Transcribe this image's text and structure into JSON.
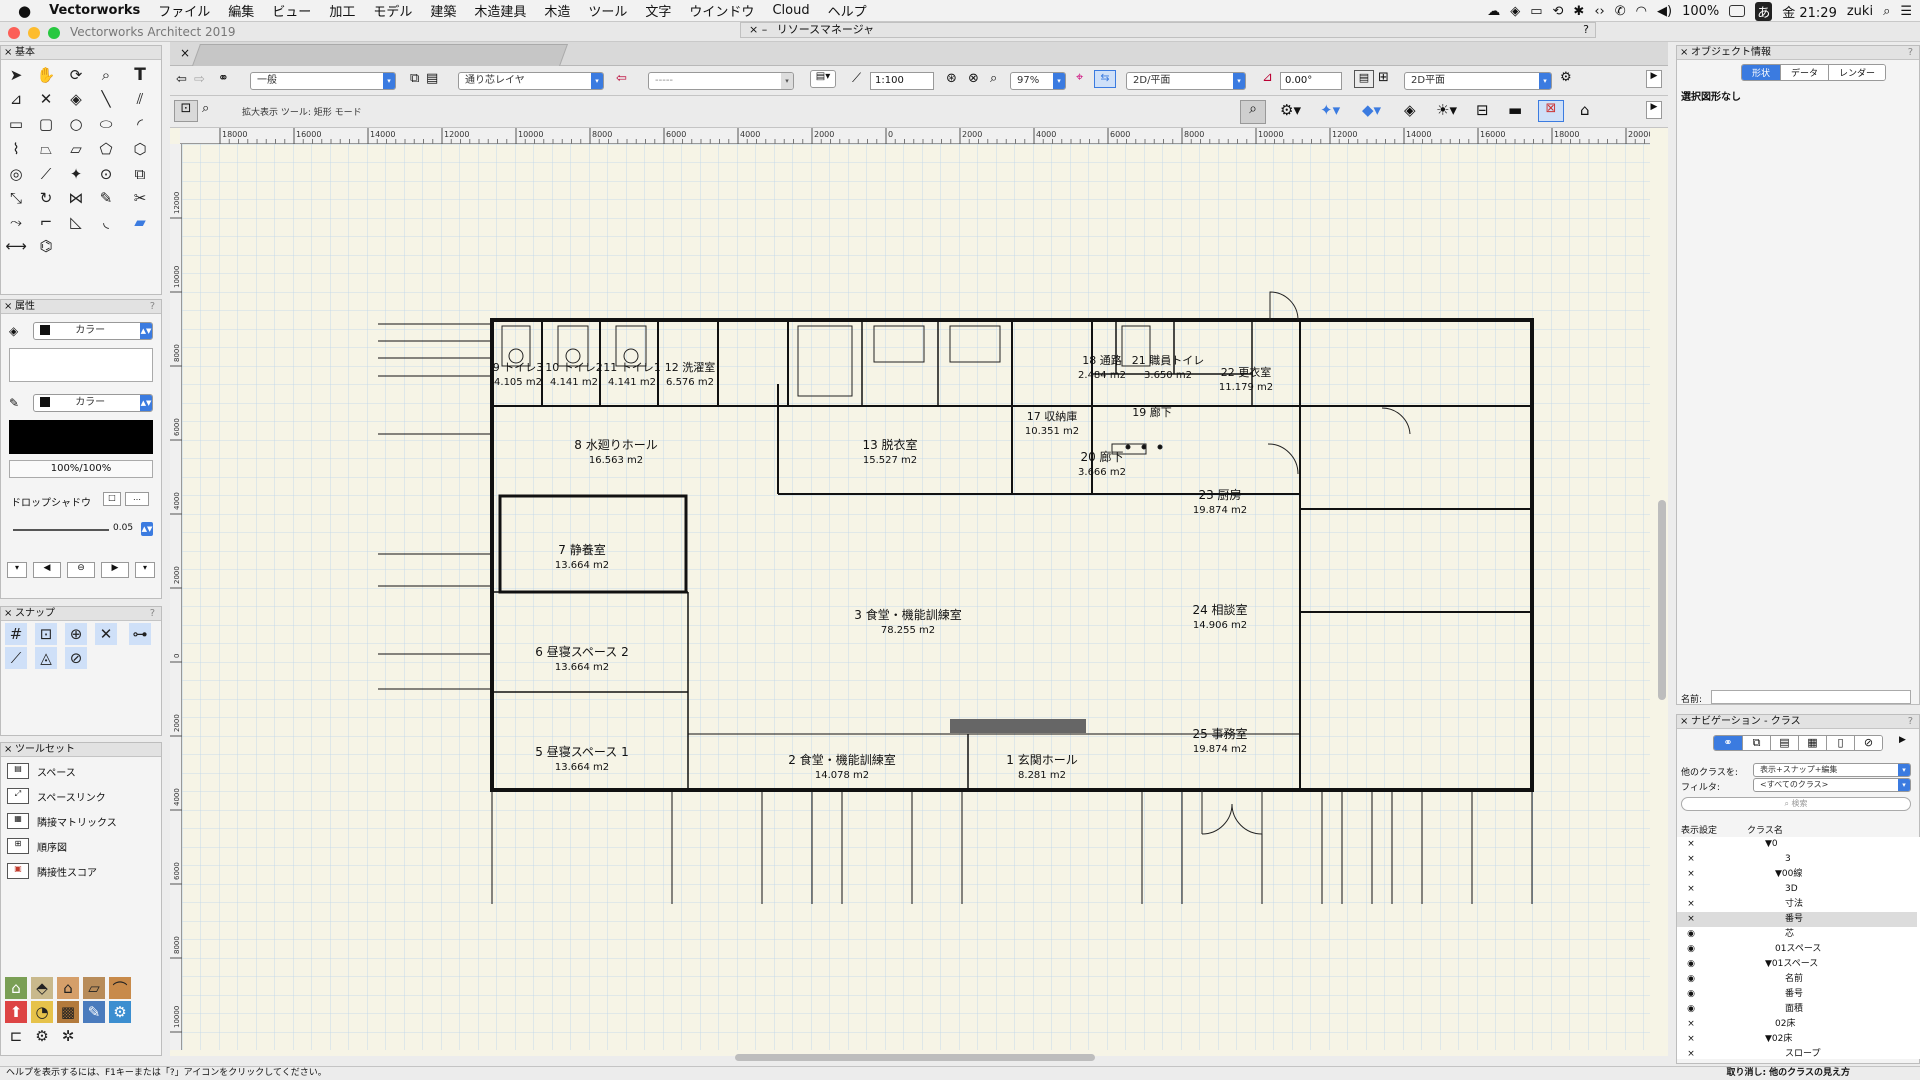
{
  "menubar": {
    "apple": "",
    "app_name": "Vectorworks",
    "items": [
      "ファイル",
      "編集",
      "ビュー",
      "加工",
      "モデル",
      "建築",
      "木造建具",
      "木造",
      "ツール",
      "文字",
      "ウインドウ",
      "Cloud",
      "ヘルプ"
    ],
    "battery": "100%",
    "clock": "金 21:29",
    "user": "zuki",
    "input_mode": "あ"
  },
  "window": {
    "title": "Vectorworks Architect 2019",
    "resource_manager": "リソースマネージャ"
  },
  "palettes": {
    "basic": {
      "title": "基本"
    },
    "attributes": {
      "title": "属性",
      "fill_label": "カラー",
      "pen_label": "カラー",
      "opacity": "100%/100%",
      "drop_shadow": "ドロップシャドウ",
      "line_weight": "0.05"
    },
    "snap": {
      "title": "スナップ"
    },
    "toolset": {
      "title": "ツールセット",
      "items": [
        "スペース",
        "スペースリンク",
        "隣接マトリックス",
        "順序図",
        "隣接性スコア"
      ]
    }
  },
  "view_bar": {
    "class": "一般",
    "layer": "通り芯レイヤ",
    "saved_view": "-----",
    "scale": "1:100",
    "zoom": "97%",
    "view": "2D/平面",
    "angle": "0.00°",
    "projection": "2D平面"
  },
  "mode_bar": {
    "text": "拡大表示 ツール: 矩形 モード"
  },
  "rulers": {
    "top": [
      "18000",
      "16000",
      "14000",
      "12000",
      "10000",
      "8000",
      "6000",
      "4000",
      "2000",
      "0",
      "2000",
      "4000",
      "6000",
      "8000",
      "10000",
      "12000",
      "14000",
      "16000",
      "18000",
      "20000"
    ],
    "left": [
      "12000",
      "10000",
      "8000",
      "6000",
      "4000",
      "2000",
      "0",
      "2000",
      "4000",
      "6000",
      "8000",
      "10000",
      "12000"
    ]
  },
  "rooms": [
    {
      "label": "9 トイレ3",
      "area": "4.105 m2"
    },
    {
      "label": "10 トイレ2",
      "area": "4.141 m2"
    },
    {
      "label": "11 トイレ1",
      "area": "4.141 m2"
    },
    {
      "label": "12 洗濯室",
      "area": "6.576 m2"
    },
    {
      "label": "17 収納庫",
      "area": "10.351 m2"
    },
    {
      "label": "18 通路",
      "area": "2.484 m2"
    },
    {
      "label": "21 職員トイレ",
      "area": "3.650 m2"
    },
    {
      "label": "22 更衣室",
      "area": "11.179 m2"
    },
    {
      "label": "19 廊下",
      "area": ""
    },
    {
      "label": "8 水廻りホール",
      "area": "16.563 m2"
    },
    {
      "label": "13 脱衣室",
      "area": "15.527 m2"
    },
    {
      "label": "20 廊下",
      "area": "3.666 m2"
    },
    {
      "label": "23 厨房",
      "area": "19.874 m2"
    },
    {
      "label": "7 静養室",
      "area": "13.664 m2"
    },
    {
      "label": "3 食堂・機能訓練室",
      "area": "78.255 m2"
    },
    {
      "label": "24 相談室",
      "area": "14.906 m2"
    },
    {
      "label": "6 昼寝スペース 2",
      "area": "13.664 m2"
    },
    {
      "label": "5 昼寝スペース 1",
      "area": "13.664 m2"
    },
    {
      "label": "2 食堂・機能訓練室",
      "area": "14.078 m2"
    },
    {
      "label": "1 玄関ホール",
      "area": "8.281 m2"
    },
    {
      "label": "25 事務室",
      "area": "19.874 m2"
    }
  ],
  "obj_info": {
    "title": "オブジェクト情報",
    "tabs": [
      "形状",
      "データ",
      "レンダー"
    ],
    "status": "選択図形なし",
    "name_label": "名前:"
  },
  "nav": {
    "title": "ナビゲーション - クラス",
    "other_classes_label": "他のクラスを:",
    "other_classes_value": "表示+スナップ+編集",
    "filter_label": "フィルタ:",
    "filter_value": "<すべてのクラス>",
    "search_placeholder": "検索",
    "col_visibility": "表示設定",
    "col_name": "クラス名",
    "rows": [
      {
        "vis": "×",
        "name": "▼0"
      },
      {
        "vis": "×",
        "name": "3"
      },
      {
        "vis": "×",
        "name": "▼00線"
      },
      {
        "vis": "×",
        "name": "3D"
      },
      {
        "vis": "×",
        "name": "寸法"
      },
      {
        "vis": "×",
        "name": "番号"
      },
      {
        "vis": "◉",
        "name": "芯"
      },
      {
        "vis": "◉",
        "name": "01スペース"
      },
      {
        "vis": "◉",
        "name": "▼01スペース"
      },
      {
        "vis": "◉",
        "name": "名前"
      },
      {
        "vis": "◉",
        "name": "番号"
      },
      {
        "vis": "◉",
        "name": "面積"
      },
      {
        "vis": "×",
        "name": "02床"
      },
      {
        "vis": "×",
        "name": "▼02床"
      },
      {
        "vis": "×",
        "name": "スロープ"
      }
    ]
  },
  "statusbar": {
    "help": "ヘルプを表示するには、F1キーまたは「?」アイコンをクリックしてください。",
    "undo": "取り消し: 他のクラスの見え方"
  }
}
